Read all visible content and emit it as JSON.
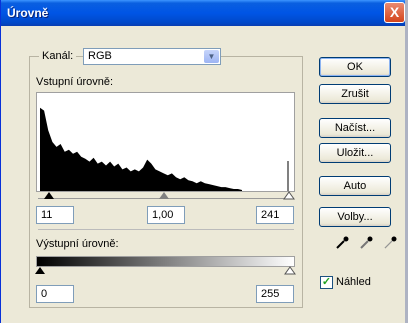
{
  "window": {
    "title": "Úrovně",
    "close_glyph": "X"
  },
  "channel": {
    "label": "Kanál:",
    "value": "RGB"
  },
  "input_levels": {
    "label": "Vstupní úrovně:",
    "black": "11",
    "gamma": "1,00",
    "white": "241"
  },
  "output_levels": {
    "label": "Výstupní úrovně:",
    "black": "0",
    "white": "255"
  },
  "buttons": {
    "ok": "OK",
    "cancel": "Zrušit",
    "load": "Načíst...",
    "save": "Uložit...",
    "auto": "Auto",
    "options": "Volby..."
  },
  "preview": {
    "label": "Náhled",
    "checked": true,
    "check_glyph": "✓"
  },
  "histogram": {
    "heights": [
      0.85,
      0.82,
      0.62,
      0.5,
      0.45,
      0.48,
      0.4,
      0.42,
      0.38,
      0.4,
      0.35,
      0.33,
      0.3,
      0.34,
      0.28,
      0.3,
      0.26,
      0.3,
      0.25,
      0.28,
      0.22,
      0.24,
      0.2,
      0.22,
      0.2,
      0.24,
      0.32,
      0.28,
      0.22,
      0.2,
      0.18,
      0.16,
      0.18,
      0.14,
      0.12,
      0.14,
      0.11,
      0.1,
      0.08,
      0.1,
      0.08,
      0.07,
      0.06,
      0.05,
      0.04,
      0.04,
      0.03,
      0.02,
      0.02,
      0.01
    ]
  },
  "colors": {
    "title_bar": "#0055e5",
    "dialog_bg": "#ece9d8",
    "button_border": "#003c74"
  }
}
